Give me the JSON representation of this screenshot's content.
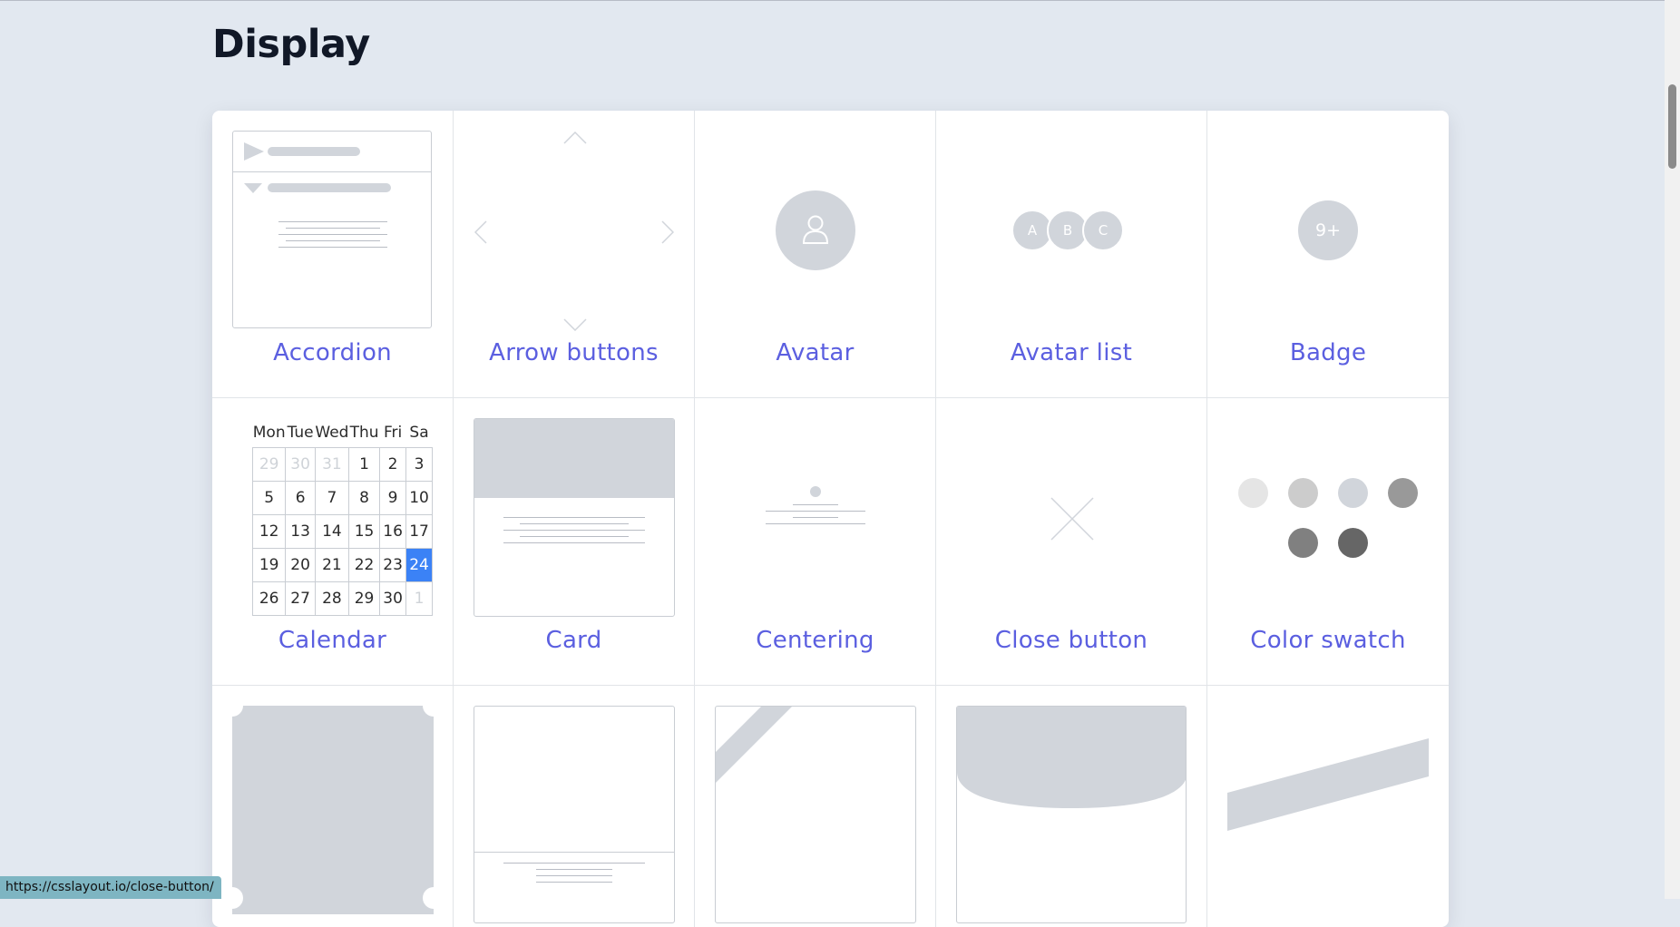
{
  "page": {
    "title": "Display"
  },
  "items": [
    {
      "label": "Accordion"
    },
    {
      "label": "Arrow buttons"
    },
    {
      "label": "Avatar"
    },
    {
      "label": "Avatar list"
    },
    {
      "label": "Badge"
    },
    {
      "label": "Calendar"
    },
    {
      "label": "Card"
    },
    {
      "label": "Centering"
    },
    {
      "label": "Close button"
    },
    {
      "label": "Color swatch"
    }
  ],
  "avatar_list": [
    "A",
    "B",
    "C"
  ],
  "badge": {
    "text": "9+"
  },
  "calendar": {
    "weekdays": [
      "Mon",
      "Tue",
      "Wed",
      "Thu",
      "Fri",
      "Sa"
    ],
    "rows": [
      [
        "29",
        "30",
        "31",
        "1",
        "2",
        "3"
      ],
      [
        "5",
        "6",
        "7",
        "8",
        "9",
        "10"
      ],
      [
        "12",
        "13",
        "14",
        "15",
        "16",
        "17"
      ],
      [
        "19",
        "20",
        "21",
        "22",
        "23",
        "24"
      ],
      [
        "26",
        "27",
        "28",
        "29",
        "30",
        "1"
      ]
    ]
  },
  "colors": {
    "accent": "#5b5fe0",
    "selected_day": "#3b82f6",
    "swatches": [
      "#e5e5e5",
      "#cccccc",
      "#d1d5db",
      "#999999",
      "#808080",
      "#666666"
    ]
  },
  "status_bar": {
    "url": "https://csslayout.io/close-button/"
  }
}
